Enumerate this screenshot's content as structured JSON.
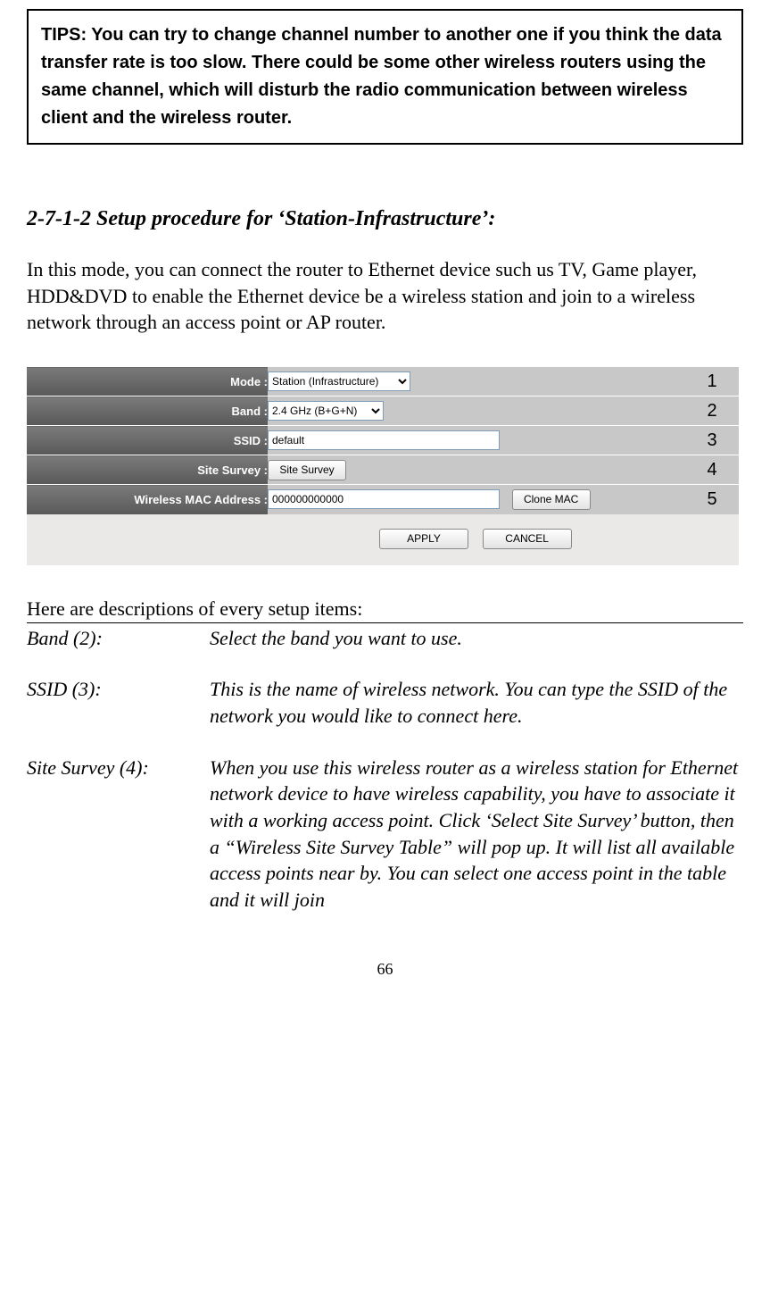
{
  "tips": "TIPS: You can try to change channel number to another one if you think the data transfer rate is too slow. There could be some other wireless routers using the same channel, which will disturb the radio communication between wireless client and the wireless router.",
  "section_title": "2-7-1-2 Setup procedure for ‘Station-Infrastructure’:",
  "intro": "In this mode, you can connect the router to Ethernet device such us TV, Game player, HDD&DVD to enable the Ethernet device be a wireless station and join to a wireless network through an access point or AP router.",
  "panel": {
    "rows": {
      "mode": {
        "label": "Mode :",
        "value": "Station (Infrastructure)",
        "annot": "1"
      },
      "band": {
        "label": "Band :",
        "value": "2.4 GHz (B+G+N)",
        "annot": "2"
      },
      "ssid": {
        "label": "SSID :",
        "value": "default",
        "annot": "3"
      },
      "survey": {
        "label": "Site Survey :",
        "button": "Site Survey",
        "annot": "4"
      },
      "mac": {
        "label": "Wireless MAC Address :",
        "value": "000000000000",
        "button": "Clone MAC",
        "annot": "5"
      }
    },
    "apply": "APPLY",
    "cancel": "CANCEL"
  },
  "desc_intro": "Here are descriptions of every setup items:",
  "desc": {
    "band": {
      "label": "Band (2):",
      "text": "Select the band you want to use."
    },
    "ssid": {
      "label": "SSID (3):",
      "text": "This is the name of wireless network. You can type the SSID of the network you would like to connect here."
    },
    "survey": {
      "label": "Site Survey (4):",
      "text": "When you use this wireless router as a wireless station for Ethernet network device to have wireless capability, you have to associate it with a working access point. Click ‘Select Site Survey’ button, then a “Wireless Site Survey Table” will pop up. It will list all available access points near by. You can select one access point in the table and it will join"
    }
  },
  "page_number": "66"
}
